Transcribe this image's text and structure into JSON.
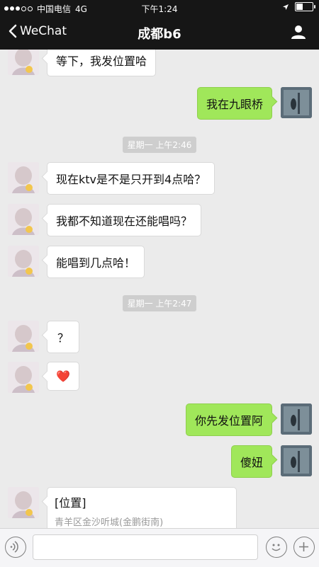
{
  "status_bar": {
    "carrier": "中国电信",
    "network": "4G",
    "time": "下午1:24"
  },
  "nav": {
    "back_label": "WeChat",
    "title": "成都b6"
  },
  "messages": [
    {
      "text": "等下，我发位置哈"
    },
    {
      "text": "我在九眼桥"
    },
    {
      "text": "星期一 上午2:46"
    },
    {
      "text": "现在ktv是不是只开到4点哈？"
    },
    {
      "text": "我都不知道现在还能唱吗？"
    },
    {
      "text": "能唱到几点哈！"
    },
    {
      "text": "星期一 上午2:47"
    },
    {
      "text": "？"
    },
    {
      "text": "❤️"
    },
    {
      "text": "你先发位置阿"
    },
    {
      "text": "傻妞"
    },
    {
      "title": "[位置]",
      "address": "青羊区金沙听城(金鹏街南)"
    }
  ],
  "colors": {
    "bar": "#161616",
    "chat_bg": "#ebebeb",
    "outgoing": "#a0e75a",
    "incoming": "#ffffff"
  }
}
